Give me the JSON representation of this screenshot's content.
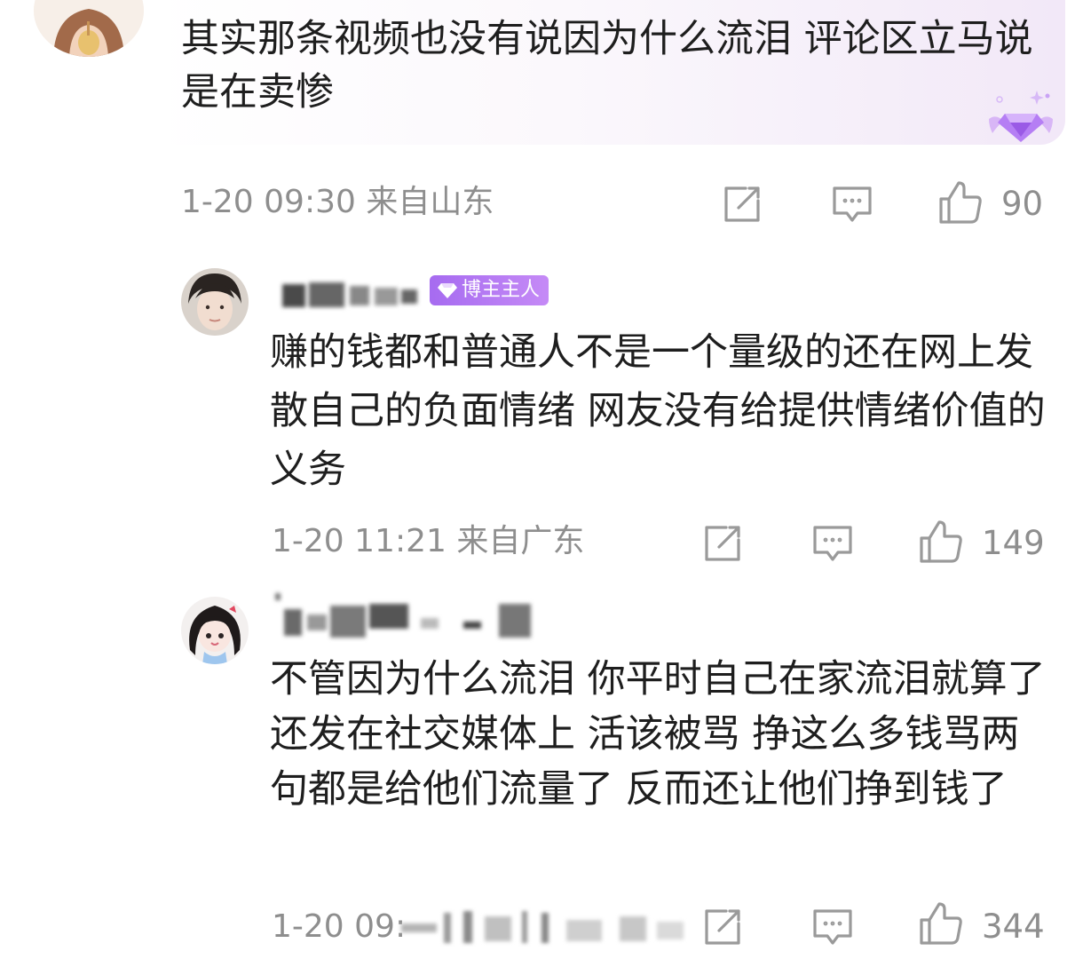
{
  "colors": {
    "text": "#1e1e1e",
    "meta": "#8e8e8e",
    "icon": "#9a9a9a",
    "badge": "#b07cf2"
  },
  "comments": [
    {
      "text": "其实那条视频也没有说因为什么流泪 评论区立马说是在卖惨",
      "time_location": "1-20 09:30 来自山东",
      "likes": "90",
      "vip_icon": "diamond-wing-icon"
    },
    {
      "badge": "博主主人",
      "text": "赚的钱都和普通人不是一个量级的还在网上发散自己的负面情绪 网友没有给提供情绪价值的义务",
      "time_location": "1-20 11:21 来自广东",
      "likes": "149"
    },
    {
      "text": "不管因为什么流泪 你平时自己在家流泪就算了 还发在社交媒体上 活该被骂 挣这么多钱骂两句都是给他们流量了 反而还让他们挣到钱了",
      "time_prefix": "1-20 09:",
      "likes": "344"
    }
  ],
  "icons": {
    "share": "share-icon",
    "comment": "comment-icon",
    "like": "thumbs-up-icon"
  }
}
